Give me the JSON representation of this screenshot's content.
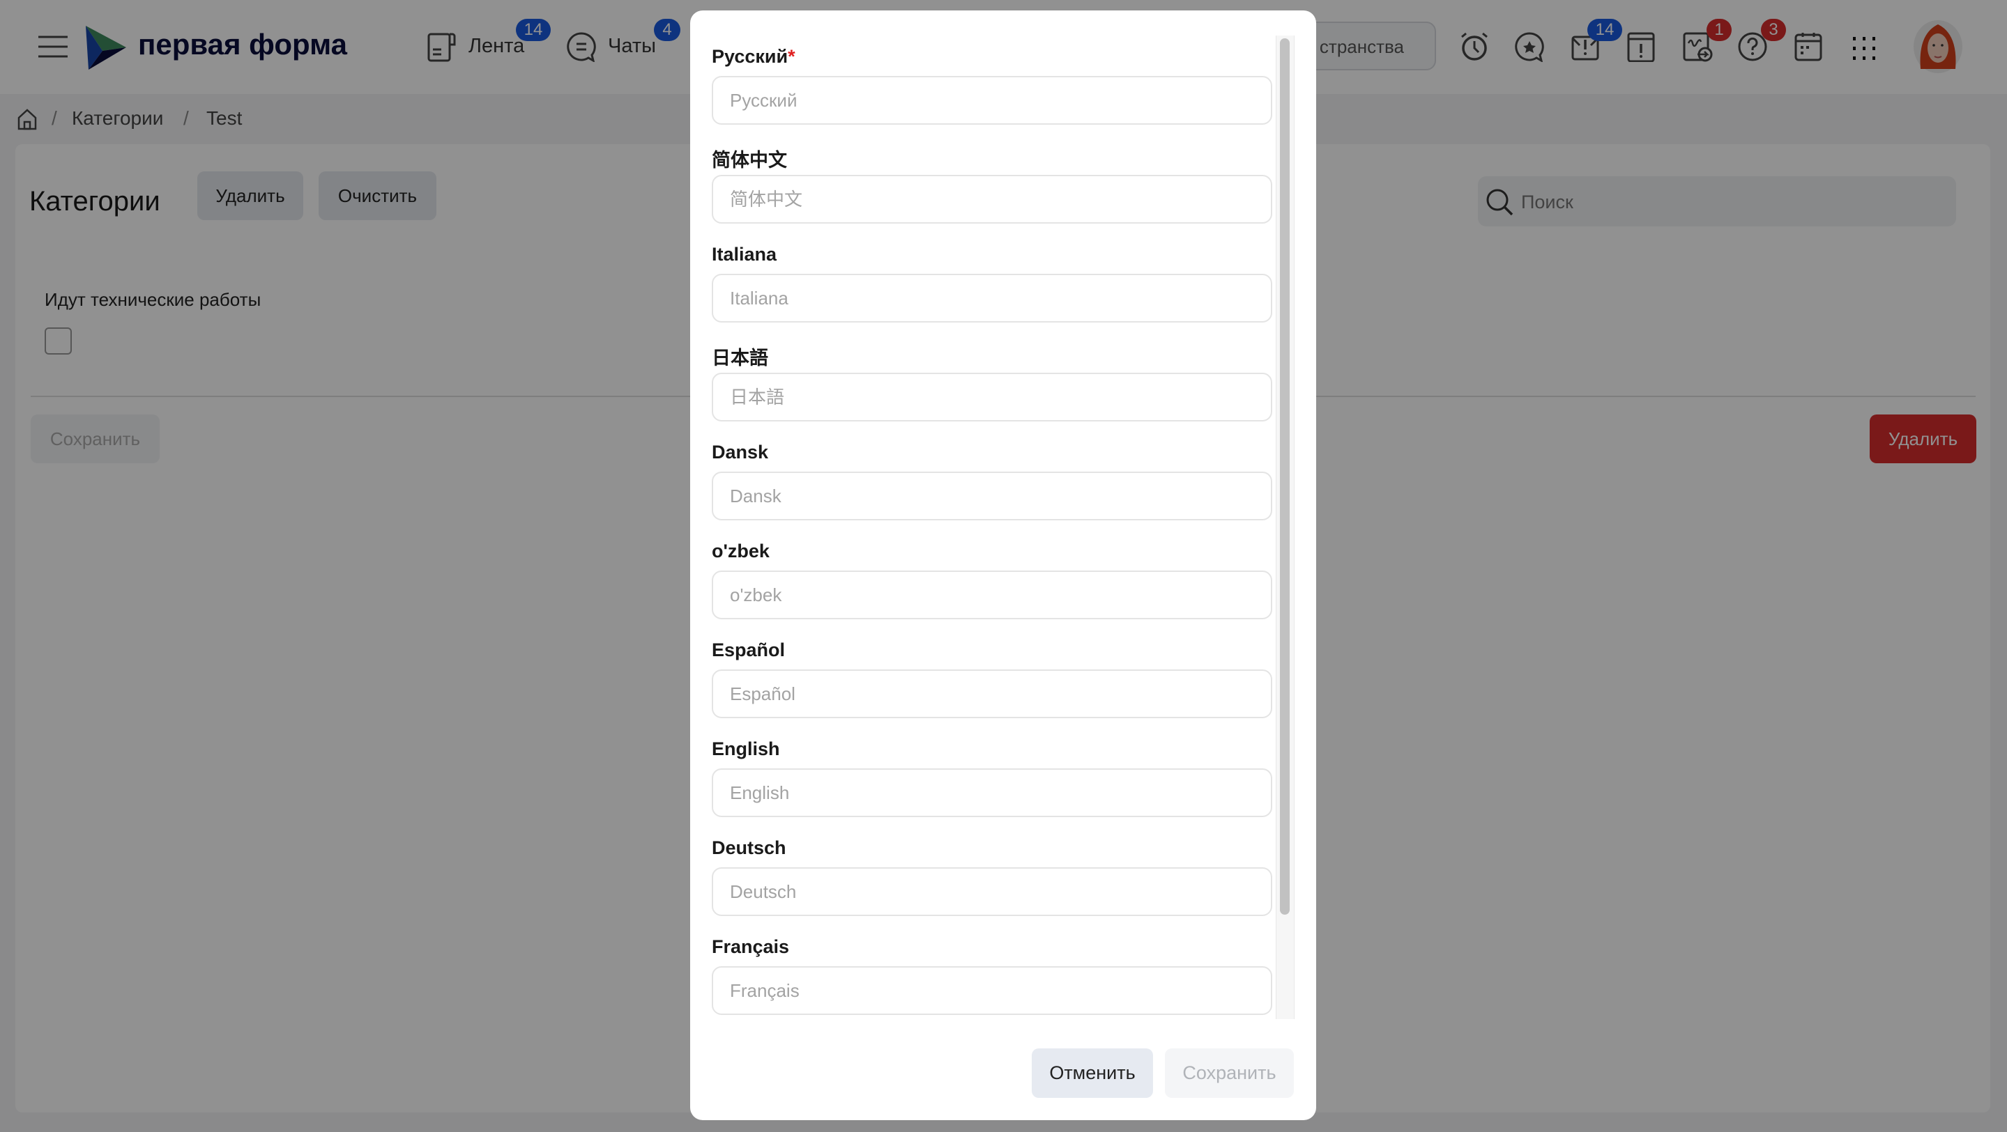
{
  "header": {
    "logo_text": "первая форма",
    "nav": [
      {
        "label": "Лента",
        "badge": "14",
        "icon": "feed-icon"
      },
      {
        "label": "Чаты",
        "badge": "4",
        "icon": "chat-icon"
      }
    ],
    "spaces_search_text": "странства",
    "icons": [
      {
        "name": "alarm-clock-icon"
      },
      {
        "name": "favorites-chat-icon"
      },
      {
        "name": "mail-alert-icon",
        "badge": "14",
        "badge_color": "#1a5ae0"
      },
      {
        "name": "notice-icon"
      },
      {
        "name": "signature-icon",
        "badge": "1",
        "badge_color": "#d62c2c"
      },
      {
        "name": "help-icon",
        "badge": "3",
        "badge_color": "#d62c2c"
      },
      {
        "name": "calendar-icon"
      },
      {
        "name": "apps-grid-icon"
      }
    ]
  },
  "breadcrumb": {
    "items": [
      "Категории",
      "Test"
    ],
    "separator": "/"
  },
  "page": {
    "title": "Категории",
    "delete_label": "Удалить",
    "clear_label": "Очистить",
    "search_placeholder": "Поиск",
    "maintenance_label": "Идут технические работы",
    "maintenance_checked": false,
    "save_label": "Сохранить",
    "delete_bottom_label": "Удалить",
    "danger_color": "#d62c2c"
  },
  "modal": {
    "fields": [
      {
        "label": "Русский",
        "placeholder": "Русский",
        "required": true,
        "value": ""
      },
      {
        "label": "简体中文",
        "placeholder": "简体中文",
        "value": ""
      },
      {
        "label": "Italiana",
        "placeholder": "Italiana",
        "value": ""
      },
      {
        "label": "日本語",
        "placeholder": "日本語",
        "value": ""
      },
      {
        "label": "Dansk",
        "placeholder": "Dansk",
        "value": ""
      },
      {
        "label": "o'zbek",
        "placeholder": "o'zbek",
        "value": ""
      },
      {
        "label": "Español",
        "placeholder": "Español",
        "value": ""
      },
      {
        "label": "English",
        "placeholder": "English",
        "value": ""
      },
      {
        "label": "Deutsch",
        "placeholder": "Deutsch",
        "value": ""
      },
      {
        "label": "Français",
        "placeholder": "Français",
        "value": ""
      }
    ],
    "required_mark": "*",
    "cancel_label": "Отменить",
    "save_label": "Сохранить"
  }
}
